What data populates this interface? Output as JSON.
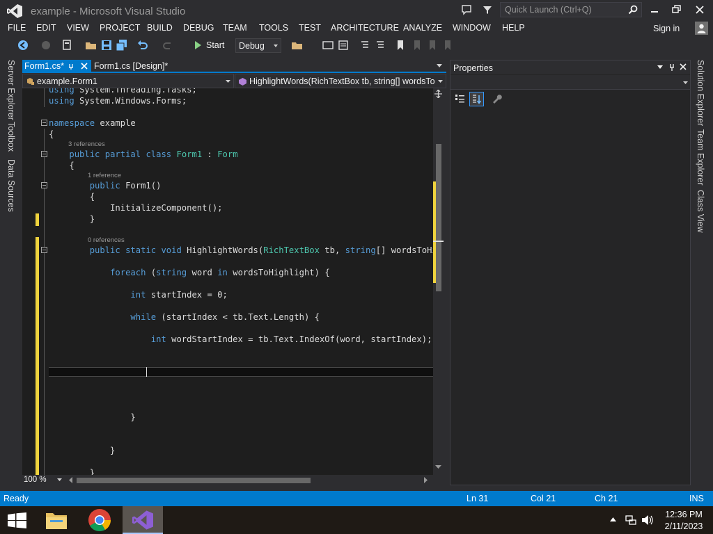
{
  "window": {
    "title": "example - Microsoft Visual Studio",
    "quick_launch_placeholder": "Quick Launch (Ctrl+Q)"
  },
  "menu": [
    "FILE",
    "EDIT",
    "VIEW",
    "PROJECT",
    "BUILD",
    "DEBUG",
    "TEAM",
    "TOOLS",
    "TEST",
    "ARCHITECTURE",
    "ANALYZE",
    "WINDOW",
    "HELP"
  ],
  "account": {
    "signin_label": "Sign in"
  },
  "toolbar": {
    "start_label": "Start",
    "configuration": "Debug"
  },
  "left_tool_tabs": [
    "Server Explorer",
    "Toolbox",
    "Data Sources"
  ],
  "doc_tabs": [
    {
      "label": "Form1.cs*",
      "active": true
    },
    {
      "label": "Form1.cs [Design]*",
      "active": false
    }
  ],
  "navigation": {
    "type_combo": "example.Form1",
    "member_combo": "HighlightWords(RichTextBox tb, string[] wordsToH"
  },
  "code": {
    "lines": [
      "using System.Threading.Tasks;",
      "using System.Windows.Forms;",
      "",
      "namespace example",
      "{",
      "    public partial class Form1 : Form",
      "    {",
      "        public Form1()",
      "        {",
      "            InitializeComponent();",
      "        }",
      "        public static void HighlightWords(RichTextBox tb, string[] wordsToHighl",
      "            foreach (string word in wordsToHighlight) {",
      "                int startIndex = 0;",
      "                while (startIndex < tb.Text.Length) {",
      "                    int wordStartIndex = tb.Text.IndexOf(word, startIndex);",
      "                }",
      "            }",
      "        }"
    ],
    "codelens": [
      "3 references",
      "1 reference",
      "0 references"
    ]
  },
  "editor": {
    "zoom": "100 %"
  },
  "properties": {
    "title": "Properties"
  },
  "right_tool_tabs": [
    "Solution Explorer",
    "Team Explorer",
    "Class View"
  ],
  "status": {
    "state": "Ready",
    "line": "Ln 31",
    "col": "Col 21",
    "ch": "Ch 21",
    "mode": "INS"
  },
  "taskbar": {
    "time": "12:36 PM",
    "date": "2/11/2023"
  },
  "colors": {
    "accent": "#007acc",
    "keyword": "#569cd6",
    "type": "#4ec9b0",
    "change_marker": "#efd33d",
    "background": "#2d2d30",
    "editor_background": "#1e1e1e"
  }
}
